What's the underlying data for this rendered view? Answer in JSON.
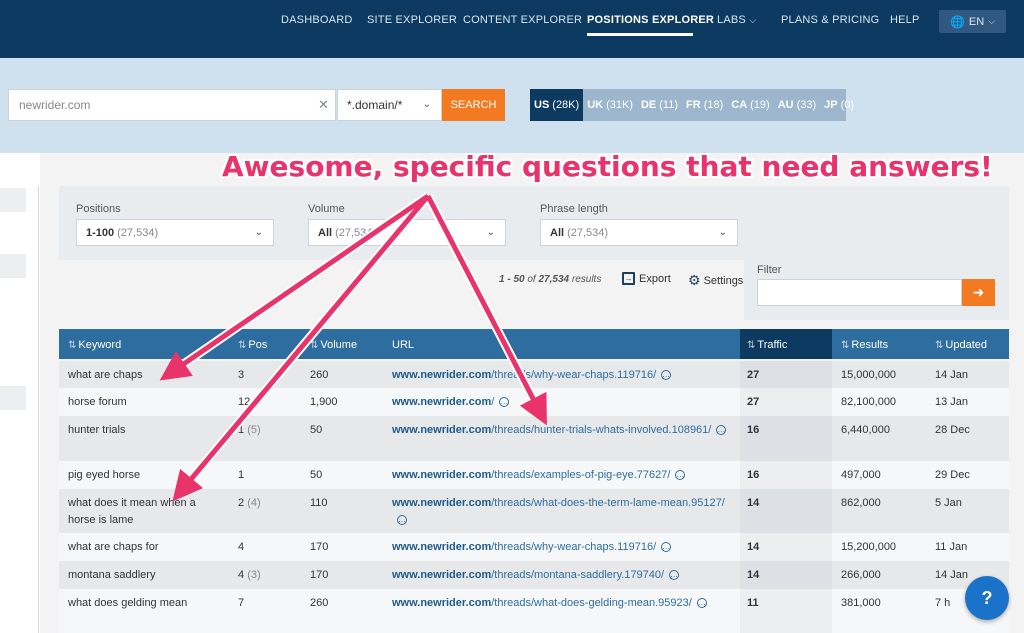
{
  "nav": {
    "items": [
      {
        "label": "Dashboard"
      },
      {
        "label": "Site Explorer"
      },
      {
        "label": "Content Explorer"
      },
      {
        "label": "Positions Explorer"
      },
      {
        "label": "Labs"
      },
      {
        "label": "Plans & Pricing"
      },
      {
        "label": "Help"
      }
    ],
    "active": "Positions Explorer",
    "lang": "EN"
  },
  "search": {
    "value": "newrider.com",
    "mode": "*.domain/*",
    "button": "SEARCH"
  },
  "countries": [
    {
      "code": "US",
      "count": "(28K)"
    },
    {
      "code": "UK",
      "count": "(31K)"
    },
    {
      "code": "DE",
      "count": "(11)"
    },
    {
      "code": "FR",
      "count": "(18)"
    },
    {
      "code": "CA",
      "count": "(19)"
    },
    {
      "code": "AU",
      "count": "(33)"
    },
    {
      "code": "JP",
      "count": "(0)"
    }
  ],
  "annotation": "Awesome, specific questions that need answers!",
  "filters": {
    "positions": {
      "label": "Positions",
      "value": "1-100",
      "count": "(27,534)"
    },
    "volume": {
      "label": "Volume",
      "value": "All",
      "count": "(27,534)"
    },
    "phrase": {
      "label": "Phrase length",
      "value": "All",
      "count": "(27,534)"
    }
  },
  "results": {
    "range": "1 - 50",
    "of": "of",
    "total": "27,534",
    "suffix": "results"
  },
  "toolbar": {
    "export": "Export",
    "settings": "Settings"
  },
  "filter_box": {
    "label": "Filter",
    "go_icon": "arrow-right-icon"
  },
  "table": {
    "headers": {
      "keyword": "Keyword",
      "pos": "Pos",
      "volume": "Volume",
      "url": "URL",
      "traffic": "Traffic",
      "results": "Results",
      "updated": "Updated"
    },
    "rows": [
      {
        "keyword": "what are chaps",
        "pos": "3",
        "pos_prev": "",
        "volume": "260",
        "url_domain": "www.newrider.com",
        "url_path": "/threads/why-wear-chaps.119716/",
        "traffic": "27",
        "results": "15,000,000",
        "updated": "14 Jan"
      },
      {
        "keyword": "horse forum",
        "pos": "12",
        "pos_prev": "",
        "volume": "1,900",
        "url_domain": "www.newrider.com",
        "url_path": "/",
        "traffic": "27",
        "results": "82,100,000",
        "updated": "13 Jan"
      },
      {
        "keyword": "hunter trials",
        "pos": "1",
        "pos_prev": "(5)",
        "volume": "50",
        "url_domain": "www.newrider.com",
        "url_path": "/threads/hunter-trials-whats-involved.108961/",
        "traffic": "16",
        "results": "6,440,000",
        "updated": "28 Dec"
      },
      {
        "keyword": "pig eyed horse",
        "pos": "1",
        "pos_prev": "",
        "volume": "50",
        "url_domain": "www.newrider.com",
        "url_path": "/threads/examples-of-pig-eye.77627/",
        "traffic": "16",
        "results": "497,000",
        "updated": "29 Dec"
      },
      {
        "keyword": "what does it mean when a horse is lame",
        "pos": "2",
        "pos_prev": "(4)",
        "volume": "110",
        "url_domain": "www.newrider.com",
        "url_path": "/threads/what-does-the-term-lame-mean.95127/",
        "traffic": "14",
        "results": "862,000",
        "updated": "5 Jan"
      },
      {
        "keyword": "what are chaps for",
        "pos": "4",
        "pos_prev": "",
        "volume": "170",
        "url_domain": "www.newrider.com",
        "url_path": "/threads/why-wear-chaps.119716/",
        "traffic": "14",
        "results": "15,200,000",
        "updated": "11 Jan"
      },
      {
        "keyword": "montana saddlery",
        "pos": "4",
        "pos_prev": "(3)",
        "volume": "170",
        "url_domain": "www.newrider.com",
        "url_path": "/threads/montana-saddlery.179740/",
        "traffic": "14",
        "results": "266,000",
        "updated": "14 Jan"
      },
      {
        "keyword": "what does gelding mean",
        "pos": "7",
        "pos_prev": "",
        "volume": "260",
        "url_domain": "www.newrider.com",
        "url_path": "/threads/what-does-gelding-mean.95923/",
        "traffic": "11",
        "results": "381,000",
        "updated": "7 h"
      }
    ]
  },
  "chat": {
    "icon": "chat-help-icon",
    "glyph": "?"
  },
  "colors": {
    "nav": "#0c3a61",
    "accent": "#f47a21",
    "annotation": "#e8336b",
    "table_header": "#2e6d9f"
  }
}
